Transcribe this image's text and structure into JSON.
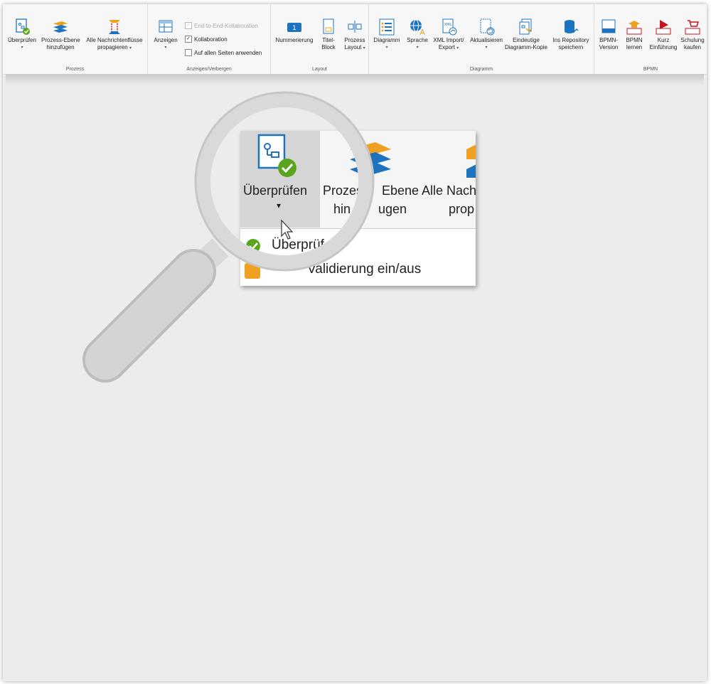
{
  "ribbon": {
    "groups": {
      "prozess": "Prozess",
      "anzeigen": "Anzeigen/Verbergen",
      "layout": "Layout",
      "diagramm": "Diagramm",
      "bpmn": "BPMN"
    },
    "buttons": {
      "ueberpruefen": "Überprüfen",
      "prozess_ebene_1": "Prozess-Ebene",
      "prozess_ebene_2": "hinzufügen",
      "alle_nachrichten_1": "Alle Nachrichtenflüsse",
      "alle_nachrichten_2": "propagieren",
      "anzeigen": "Anzeigen",
      "nummerierung": "Nummerierung",
      "titel_block_1": "Titel-",
      "titel_block_2": "Block",
      "prozess_layout_1": "Prozess",
      "prozess_layout_2": "Layout",
      "diagramm": "Diagramm",
      "sprache": "Sprache",
      "xml_1": "XML Import/",
      "xml_2": "Export",
      "aktualisieren": "Aktualisieren",
      "eindeutige_1": "Eindeutige",
      "eindeutige_2": "Diagramm-Kopie",
      "repository_1": "Ins Repository",
      "repository_2": "speichern",
      "bpmn_version_1": "BPMN-",
      "bpmn_version_2": "Version",
      "bpmn_lernen_1": "BPMN",
      "bpmn_lernen_2": "lernen",
      "kurz_1": "Kurz",
      "kurz_2": "Einführung",
      "schulung_1": "Schulung",
      "schulung_2": "kaufen",
      "caret": "▾"
    },
    "checkboxes": {
      "end_to_end": "End-to-End-Kollaboration",
      "kollaboration": "Kollaboration",
      "alle_seiten": "Auf allen Seiten anwenden"
    }
  },
  "zoom": {
    "ueberpruefen": "Überprüfen",
    "prozess_1": "Prozes",
    "prozess_1b": "Ebene",
    "prozess_2a": "hin",
    "prozess_2b": "ugen",
    "alle_1": "Alle Nach",
    "alle_2": "prop",
    "dd_item_1": "Überprüf",
    "dd_item_2a": "",
    "dd_item_2b": "Validierung ein/aus",
    "caret": "▾"
  },
  "colors": {
    "accent_blue": "#1e73be",
    "check_green": "#5aa51e",
    "orange": "#f0a020",
    "bpmn_red": "#c8101e"
  }
}
